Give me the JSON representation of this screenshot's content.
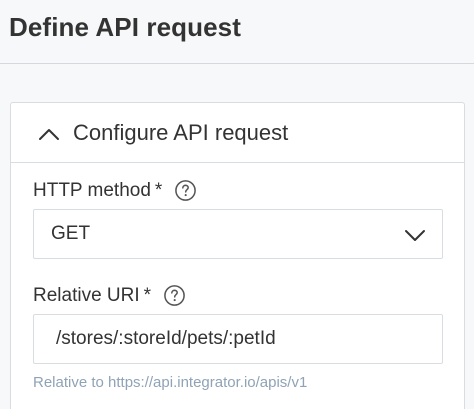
{
  "header": {
    "title": "Define API request"
  },
  "section": {
    "title": "Configure API request",
    "expanded": true
  },
  "http_method": {
    "label": "HTTP method",
    "required_mark": "*",
    "value": "GET"
  },
  "relative_uri": {
    "label": "Relative URI",
    "required_mark": "*",
    "value": "/stores/:storeId/pets/:petId",
    "helper": "Relative to https://api.integrator.io/apis/v1"
  },
  "icons": {
    "collapse": "chevron-up-icon",
    "dropdown": "chevron-down-icon",
    "help": "help-circle-icon"
  },
  "colors": {
    "text": "#333333",
    "border": "#d8dde2",
    "helper": "#8fa3b6",
    "background": "#f7f8f9"
  }
}
